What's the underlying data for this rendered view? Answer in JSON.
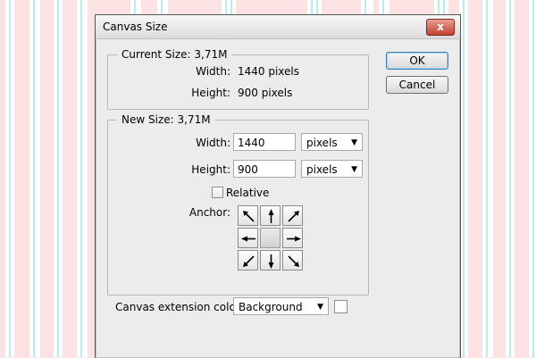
{
  "dialog": {
    "title": "Canvas Size",
    "close_label": "x"
  },
  "current_size": {
    "legend": "Current Size: 3,71M",
    "width_label": "Width:",
    "width_value": "1440 pixels",
    "height_label": "Height:",
    "height_value": "900 pixels"
  },
  "new_size": {
    "legend": "New Size: 3,71M",
    "width_label": "Width:",
    "width_value": "1440",
    "width_unit": "pixels",
    "height_label": "Height:",
    "height_value": "900",
    "height_unit": "pixels",
    "relative_label": "Relative",
    "relative_checked": false,
    "anchor_label": "Anchor:"
  },
  "extension": {
    "label": "Canvas extension color:",
    "value": "Background",
    "swatch_color": "#ffffff"
  },
  "buttons": {
    "ok": "OK",
    "cancel": "Cancel"
  },
  "colors": {
    "background_pink": "#fde2e4",
    "stripe_cyan": "#b9ecef",
    "close_red": "#c3412d"
  }
}
